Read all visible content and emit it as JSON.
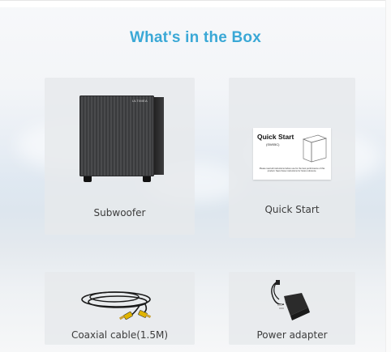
{
  "heading": "What's in the Box",
  "items": [
    {
      "label": "Subwoofer",
      "icon": "subwoofer-image"
    },
    {
      "label": "Quick Start",
      "icon": "quick-start-guide-image"
    },
    {
      "label": "Coaxial cable(1.5M)",
      "icon": "coaxial-cable-image"
    },
    {
      "label": "Power adapter",
      "icon": "power-adapter-image"
    }
  ],
  "product_text": {
    "subwoofer_logo": "ULTIMEA",
    "quick_start_title": "Quick Start",
    "quick_start_model": "(SW05C)",
    "quick_start_note": "Please read all instructions before use for the best performance of this product. Save these instructions for future reference."
  },
  "colors": {
    "heading": "#3aa8d6",
    "card_background": "#e6e9ec",
    "label_text": "#3c3c3c"
  }
}
